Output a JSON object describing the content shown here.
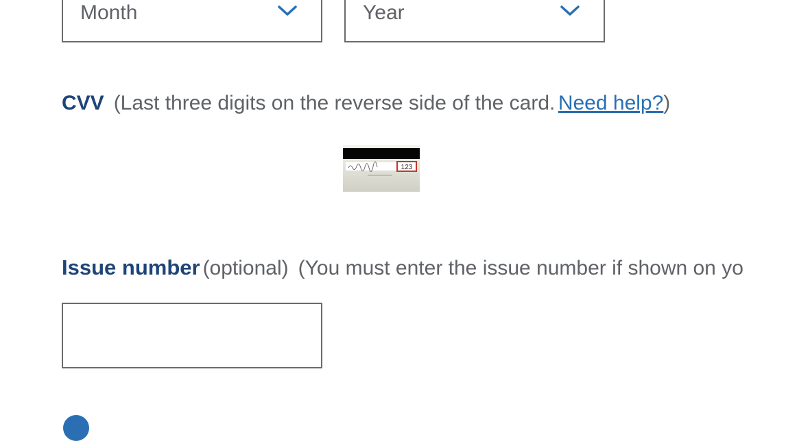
{
  "expiry": {
    "month_select": {
      "value": "Month",
      "icon": "chevron-down-icon"
    },
    "year_select": {
      "value": "Year",
      "icon": "chevron-down-icon"
    }
  },
  "cvv": {
    "label": "CVV",
    "hint_prefix": "(Last three digits on the reverse side of the card.",
    "help_link": "Need help?",
    "hint_suffix": ")",
    "card_image": {
      "icon": "card-back-cvv-icon",
      "sample_code": "123"
    }
  },
  "issue_number": {
    "label": "Issue number",
    "optional": "(optional)",
    "note": "(You must enter the issue number if shown on yo",
    "input_value": "",
    "input_placeholder": ""
  },
  "colors": {
    "label_blue": "#1e4478",
    "link_blue": "#2a6fb3",
    "muted_text": "#5f6266",
    "border": "#6b6b6b",
    "cvv_highlight": "#c0392b"
  }
}
